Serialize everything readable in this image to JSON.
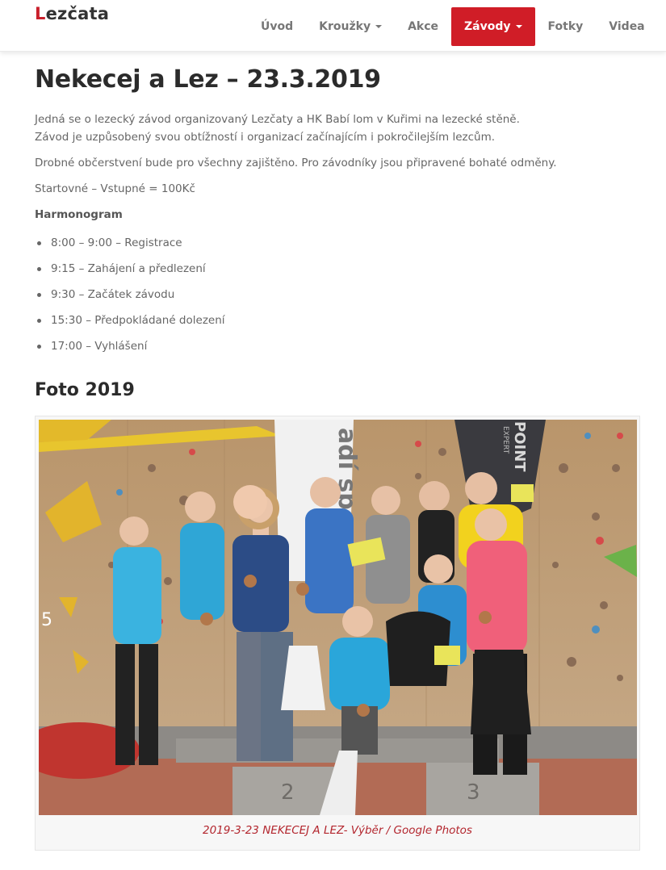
{
  "brand": {
    "first_letter": "L",
    "rest": "ezčata"
  },
  "nav": {
    "items": [
      {
        "label": "Úvod"
      },
      {
        "label": "Kroužky"
      },
      {
        "label": "Akce"
      },
      {
        "label": "Závody"
      },
      {
        "label": "Fotky"
      },
      {
        "label": "Videa"
      }
    ],
    "active": "Závody",
    "accent_color": "#d01d27"
  },
  "article": {
    "title": "Nekecej a Lez – 23.3.2019",
    "intro_line1": "Jedná se o lezecký závod organizovaný Lezčaty a HK Babí lom v Kuřimi na lezecké stěně.",
    "intro_line2": "Závod je uzpůsobený svou obtížností i organizací začínajícím i pokročilejším lezcům.",
    "refreshments": "Drobné občerstvení bude pro všechny zajištěno. Pro závodníky jsou připravené bohaté odměny.",
    "fee": "Startovné – Vstupné = 100Kč",
    "schedule_heading": "Harmonogram",
    "schedule": [
      "8:00 – 9:00 – Registrace",
      "9:15 – Zahájení a předlezení",
      "9:30 – Začátek závodu",
      "15:30 – Předpokládané dolezení",
      "17:00 – Vyhlášení"
    ],
    "photo_heading": "Foto 2019",
    "photo_caption": "2019-3-23 NEKECEJ A LEZ- Výběr / Google Photos",
    "banner_text_left": "adí sp",
    "banner_text_right": "POINT",
    "banner_text_right_sub": "EXPERT",
    "podium_numbers": [
      "5",
      "2",
      "3"
    ]
  }
}
